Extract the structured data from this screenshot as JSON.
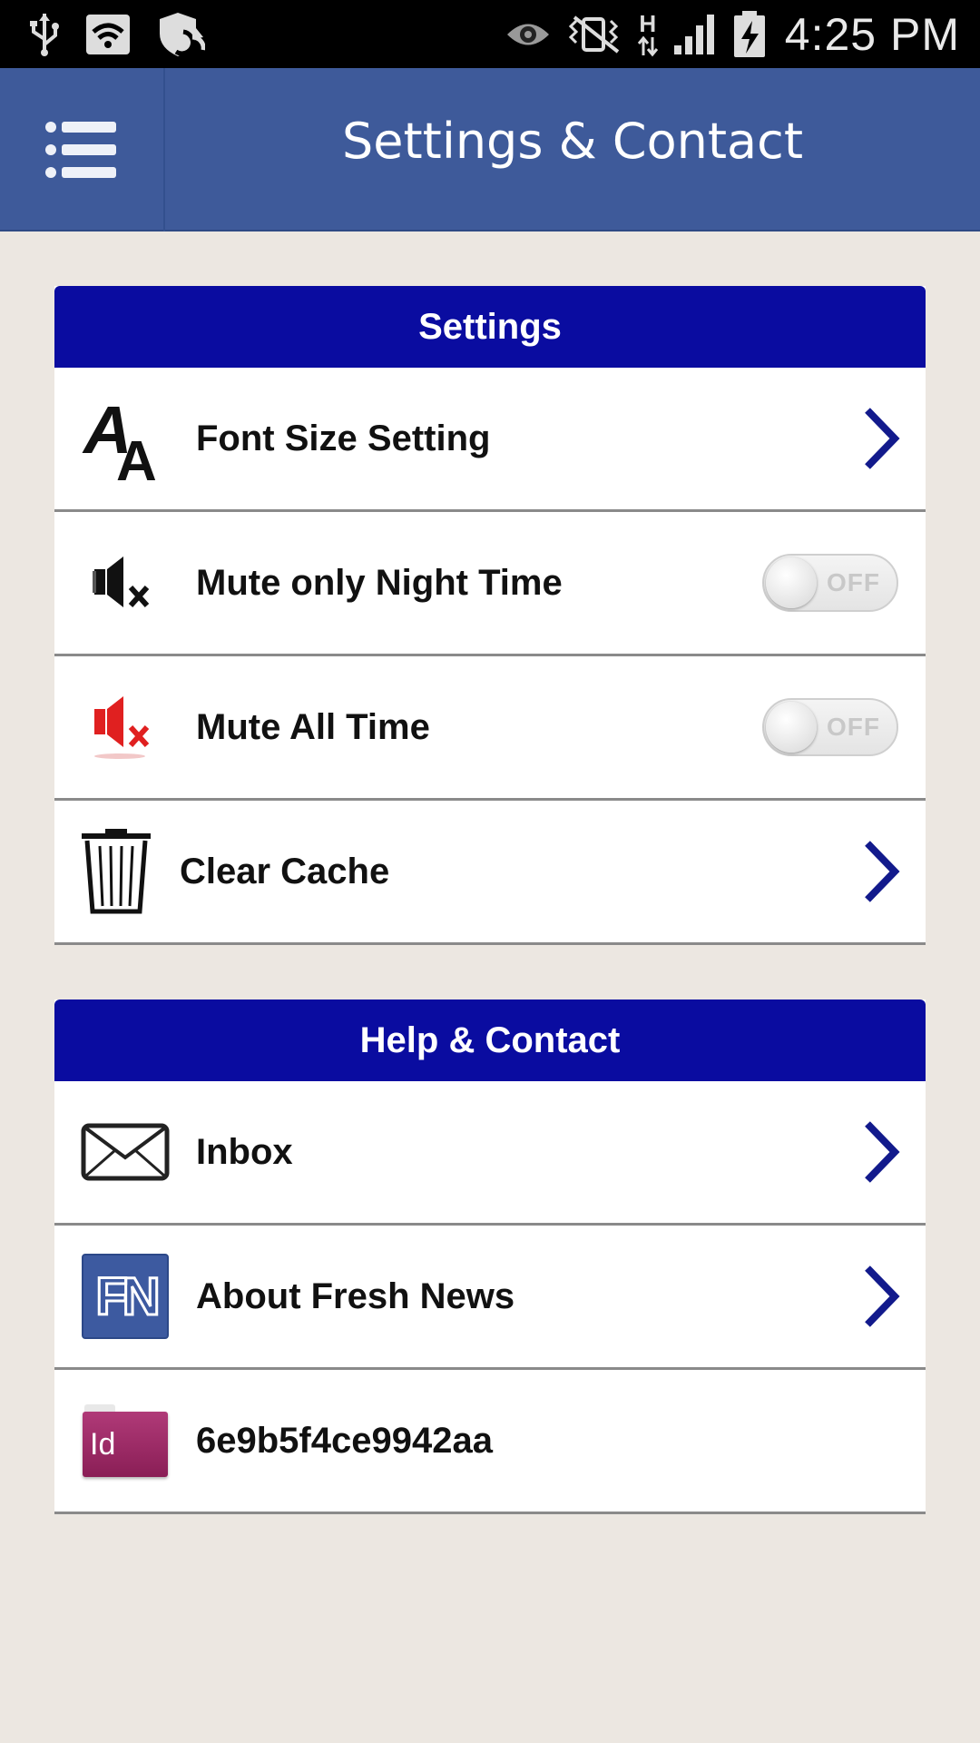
{
  "status_bar": {
    "time": "4:25 PM",
    "network_label": "H",
    "icons": [
      "usb-icon",
      "wifi-icon",
      "shield-icon",
      "eye-icon",
      "vibrate-icon",
      "network-arrows-icon",
      "signal-icon",
      "battery-charging-icon"
    ]
  },
  "app_bar": {
    "title": "Settings & Contact",
    "menu_icon": "menu-list-icon"
  },
  "settings": {
    "header": "Settings",
    "items": [
      {
        "label": "Font Size Setting",
        "icon": "font-size-icon",
        "control": "chevron"
      },
      {
        "label": "Mute only Night Time",
        "icon": "speaker-mute-black-icon",
        "control": "toggle",
        "state": "OFF"
      },
      {
        "label": "Mute All Time",
        "icon": "speaker-mute-red-icon",
        "control": "toggle",
        "state": "OFF"
      },
      {
        "label": "Clear Cache",
        "icon": "trash-icon",
        "control": "chevron"
      }
    ]
  },
  "help": {
    "header": "Help & Contact",
    "items": [
      {
        "label": "Inbox",
        "icon": "envelope-icon",
        "control": "chevron"
      },
      {
        "label": "About Fresh News",
        "icon": "fresh-news-logo-icon",
        "logo_text": "FN",
        "control": "chevron"
      },
      {
        "label": "6e9b5f4ce9942aa",
        "icon": "id-folder-icon",
        "badge_text": "Id",
        "control": "none"
      }
    ]
  },
  "colors": {
    "app_bar": "#3e5a9a",
    "section_header": "#0a0ca0",
    "chevron": "#121a8c",
    "background": "#ece7e1"
  }
}
